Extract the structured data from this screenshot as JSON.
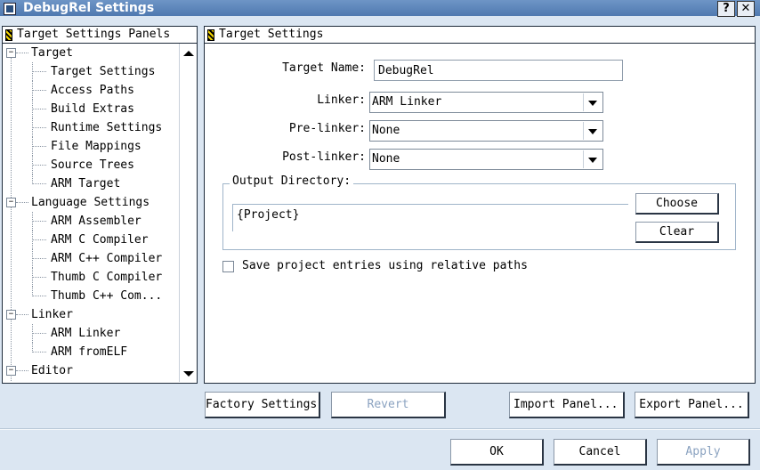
{
  "window": {
    "title": "DebugRel Settings",
    "help_label": "?",
    "close_label": "✕"
  },
  "left_panel": {
    "header": "Target Settings Panels",
    "tree": [
      {
        "label": "Target",
        "level": 0,
        "expander": "−"
      },
      {
        "label": "Target Settings",
        "level": 1
      },
      {
        "label": "Access Paths",
        "level": 1
      },
      {
        "label": "Build Extras",
        "level": 1
      },
      {
        "label": "Runtime Settings",
        "level": 1
      },
      {
        "label": "File Mappings",
        "level": 1
      },
      {
        "label": "Source Trees",
        "level": 1
      },
      {
        "label": "ARM Target",
        "level": 1
      },
      {
        "label": "Language Settings",
        "level": 0,
        "expander": "−"
      },
      {
        "label": "ARM Assembler",
        "level": 1
      },
      {
        "label": "ARM C Compiler",
        "level": 1
      },
      {
        "label": "ARM C++ Compiler",
        "level": 1
      },
      {
        "label": "Thumb C Compiler",
        "level": 1
      },
      {
        "label": "Thumb C++ Com...",
        "level": 1
      },
      {
        "label": "Linker",
        "level": 0,
        "expander": "−"
      },
      {
        "label": "ARM Linker",
        "level": 1
      },
      {
        "label": "ARM fromELF",
        "level": 1
      },
      {
        "label": "Editor",
        "level": 0,
        "expander": "−"
      }
    ]
  },
  "right_panel": {
    "header": "Target Settings",
    "target_name_label": "Target Name:",
    "target_name_value": "DebugRel",
    "linker_label": "Linker:",
    "linker_value": "ARM Linker",
    "prelinker_label": "Pre-linker:",
    "prelinker_value": "None",
    "postlinker_label": "Post-linker:",
    "postlinker_value": "None",
    "output_dir_label": "Output Directory:",
    "output_dir_value": "{Project}",
    "choose_label": "Choose",
    "clear_label": "Clear",
    "relative_paths_label": "Save project entries using relative paths",
    "relative_paths_checked": false
  },
  "panel_buttons": {
    "factory": "Factory Settings",
    "revert": "Revert",
    "import": "Import Panel...",
    "export": "Export Panel..."
  },
  "dialog_buttons": {
    "ok": "OK",
    "cancel": "Cancel",
    "apply": "Apply"
  },
  "colors": {
    "window_bg": "#dbe6f2",
    "titlebar": "#5a82b8",
    "disabled_text": "#8aa2c0"
  }
}
